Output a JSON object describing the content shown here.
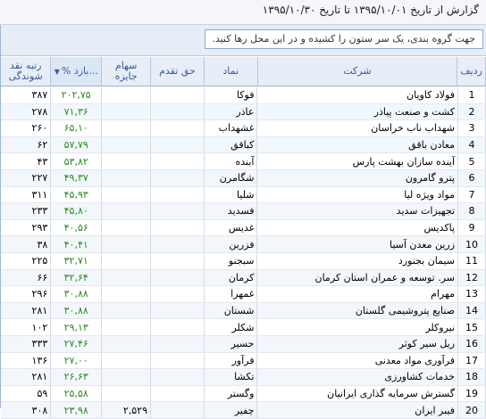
{
  "report_title": "گزارش از تاریخ ۱۳۹۵/۱۰/۰۱ تا تاریخ ۱۳۹۵/۱۰/۳۰",
  "group_hint": "جهت گروه بندی، یک سر ستون را کشیده و در این محل رها کنید.",
  "columns": {
    "rank_label": "رتبه نقد شوندگی",
    "pct_label": "% بازد...",
    "stock_label": "سهام جایزه",
    "right_label": "حق تقدم",
    "symbol_label": "نماد",
    "company_label": "شرکت",
    "row_label": "ردیف"
  },
  "sort_icon": "sort-descending-icon",
  "colors": {
    "pct_text": "#2b8a1f",
    "header_text": "#3b5998",
    "alt_row": "#f2f7fc"
  },
  "rows": [
    {
      "rank": "۳۸۷",
      "pct": "۲۰۲,۷۵",
      "stock": "",
      "right": "",
      "symbol": "فوکا",
      "company": "فولاد کاویان",
      "n": "1"
    },
    {
      "rank": "۲۷۸",
      "pct": "۷۱,۳۶",
      "stock": "",
      "right": "",
      "symbol": "عاذر",
      "company": "کشت و صنعت پیاذر",
      "n": "2"
    },
    {
      "rank": "۲۶۰",
      "pct": "۶۵,۱۰",
      "stock": "",
      "right": "",
      "symbol": "غشهداب",
      "company": "شهداب ناب خراسان",
      "n": "3"
    },
    {
      "rank": "۶۲",
      "pct": "۵۷,۷۹",
      "stock": "",
      "right": "",
      "symbol": "کباقق",
      "company": "معادن باقق",
      "n": "4"
    },
    {
      "rank": "۴۳",
      "pct": "۵۳,۸۲",
      "stock": "",
      "right": "",
      "symbol": "آبنده",
      "company": "آینده سازان بهشت پارس",
      "n": "5"
    },
    {
      "rank": "۲۲۷",
      "pct": "۴۹,۳۷",
      "stock": "",
      "right": "",
      "symbol": "شگامرن",
      "company": "پترو گامرون",
      "n": "6"
    },
    {
      "rank": "۳۱۱",
      "pct": "۴۵,۹۳",
      "stock": "",
      "right": "",
      "symbol": "شلیا",
      "company": "مواد ویژه لیا",
      "n": "7"
    },
    {
      "rank": "۲۳۳",
      "pct": "۴۵,۸۰",
      "stock": "",
      "right": "",
      "symbol": "فسدید",
      "company": "تجهیزات سدید",
      "n": "8"
    },
    {
      "rank": "۲۹۳",
      "pct": "۴۰,۵۶",
      "stock": "",
      "right": "",
      "symbol": "غدیس",
      "company": "پاکدیس",
      "n": "9"
    },
    {
      "rank": "۳۸",
      "pct": "۴۰,۴۱",
      "stock": "",
      "right": "",
      "symbol": "فزرین",
      "company": "زرین معدن آسیا",
      "n": "10"
    },
    {
      "rank": "۲۲۵",
      "pct": "۳۲,۷۱",
      "stock": "",
      "right": "",
      "symbol": "سبجنو",
      "company": "سیمان بجنورد",
      "n": "11"
    },
    {
      "rank": "۶۶",
      "pct": "۳۲,۶۴",
      "stock": "",
      "right": "",
      "symbol": "کرمان",
      "company": "سر. توسعه و عمران استان کرمان",
      "n": "12"
    },
    {
      "rank": "۲۹۶",
      "pct": "۳۰,۸۸",
      "stock": "",
      "right": "",
      "symbol": "غمهرا",
      "company": "مهرام",
      "n": "13"
    },
    {
      "rank": "۲۸۱",
      "pct": "۳۰,۸۸",
      "stock": "",
      "right": "",
      "symbol": "شستان",
      "company": "صنایع پتروشیمی گلستان",
      "n": "14"
    },
    {
      "rank": "۱۰۲",
      "pct": "۲۹,۱۳",
      "stock": "",
      "right": "",
      "symbol": "شکلر",
      "company": "نیروکلر",
      "n": "15"
    },
    {
      "rank": "۳۳۳",
      "pct": "۲۷,۴۶",
      "stock": "",
      "right": "",
      "symbol": "حسیر",
      "company": "ریل سیر کوثر",
      "n": "16"
    },
    {
      "rank": "۱۳۶",
      "pct": "۲۷,۰۰",
      "stock": "",
      "right": "",
      "symbol": "فرآور",
      "company": "فرآوری مواد معدنی",
      "n": "17"
    },
    {
      "rank": "۲۸۱",
      "pct": "۲۶,۶۳",
      "stock": "",
      "right": "",
      "symbol": "تکشا",
      "company": "خدمات کشاورزی",
      "n": "18"
    },
    {
      "rank": "۵۹",
      "pct": "۲۵,۵۸",
      "stock": "",
      "right": "",
      "symbol": "وگستر",
      "company": "گسترش سرمایه گذاری ایرانیان",
      "n": "19"
    },
    {
      "rank": "۳۰۸",
      "pct": "۲۳,۹۸",
      "stock": "۲,۵۲۹",
      "right": "",
      "symbol": "چفیر",
      "company": "فیبر ایران",
      "n": "20"
    }
  ]
}
